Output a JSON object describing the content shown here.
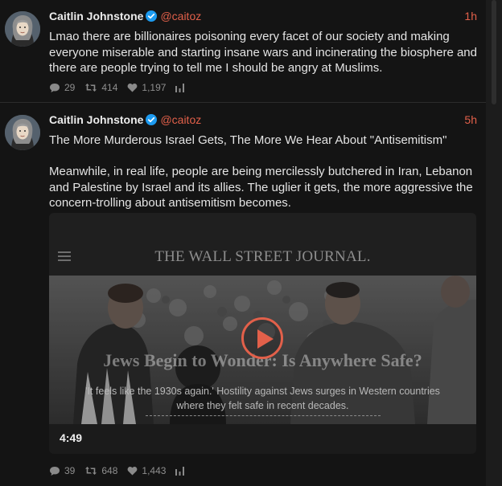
{
  "colors": {
    "accent": "#e2604a",
    "background": "#141414",
    "verified": "#1d9bf0"
  },
  "tweets": [
    {
      "author_name": "Caitlin Johnstone",
      "handle": "@caitoz",
      "time": "1h",
      "text": "Lmao there are billionaires poisoning every facet of our society and making everyone miserable and starting insane wars and incinerating the biosphere and there are people trying to tell me I should be angry at Muslims.",
      "replies": "29",
      "retweets": "414",
      "likes": "1,197"
    },
    {
      "author_name": "Caitlin Johnstone",
      "handle": "@caitoz",
      "time": "5h",
      "title": "The More Murderous Israel Gets, The More We Hear About \"Antisemitism\"",
      "text": "Meanwhile, in real life, people are being mercilessly butchered in Iran, Lebanon and Palestine by Israel and its allies. The uglier it gets, the more aggressive the concern-trolling about antisemitism becomes.",
      "media": {
        "logo": "THE WALL STREET JOURNAL.",
        "headline": "Jews Begin to Wonder: Is Anywhere Safe?",
        "subtitle": "'It feels like the 1930s again.' Hostility against Jews surges in Western countries where they felt safe in recent decades.",
        "duration": "4:49"
      },
      "replies": "39",
      "retweets": "648",
      "likes": "1,443"
    }
  ],
  "icons": {
    "reply": "speech-bubble-icon",
    "retweet": "retweet-icon",
    "like": "heart-icon",
    "stats": "bar-chart-icon",
    "verified": "verified-badge-icon",
    "menu": "hamburger-menu-icon",
    "play": "play-icon"
  }
}
